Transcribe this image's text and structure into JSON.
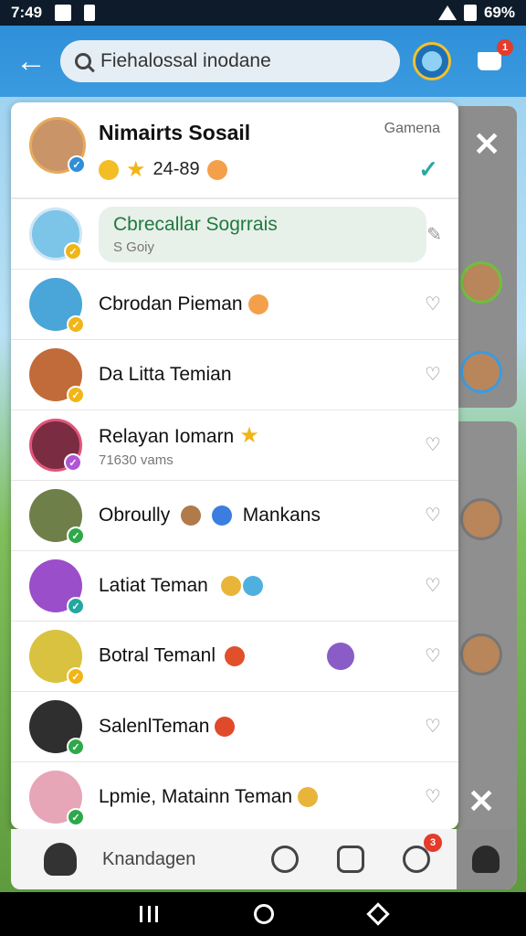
{
  "status_bar": {
    "time": "7:49",
    "battery": "69%"
  },
  "search": {
    "value": "Fiehalossal inodane",
    "placeholder": "Fiehalossal inodane"
  },
  "cart": {
    "badge": "1"
  },
  "header": {
    "title": "Nimairts Sosail",
    "stats": "24-89",
    "right_label": "Gamena"
  },
  "friends": [
    {
      "name": "Cbrecallar Sogrrais",
      "sub": "S Goiy",
      "highlight": true,
      "avatar_color": "#7cc4e8",
      "badge_color": "#f0b516"
    },
    {
      "name": "Cbrodan Pieman",
      "sub": "",
      "avatar_color": "#4aa6d8",
      "badge_color": "#f0b516"
    },
    {
      "name": "Da Litta Temian",
      "sub": "",
      "avatar_color": "#c26b3a",
      "badge_color": "#f0b516"
    },
    {
      "name": "Relayan Iomarn",
      "sub": "71630 vams",
      "avatar_color": "#7a2c42",
      "badge_color": "#b055d6"
    },
    {
      "name": "Obroully",
      "name2": "Mankans",
      "sub": "",
      "avatar_color": "#6f7f4a",
      "badge_color": "#2ea84a"
    },
    {
      "name": "Latiat Teman",
      "sub": "",
      "avatar_color": "#9b4ec9",
      "badge_color": "#23a7a0"
    },
    {
      "name": "Botral Temanl",
      "sub": "",
      "avatar_color": "#d9c23f",
      "badge_color": "#f0b516"
    },
    {
      "name": "SalenlTeman",
      "sub": "",
      "avatar_color": "#2f2f2f",
      "badge_color": "#2ea84a"
    },
    {
      "name": "Lpmie, Matainn Teman",
      "sub": "",
      "avatar_color": "#e6a6b8",
      "badge_color": "#2ea84a"
    }
  ],
  "bottom_nav": {
    "label": "Knandagen",
    "notification_badge": "3"
  },
  "colors": {
    "app_bar": "#3b9be0",
    "accent_green": "#2ea84a",
    "badge_red": "#e43b2a"
  },
  "icons": [
    "back-arrow-icon",
    "search-icon",
    "profile-icon",
    "cart-icon",
    "close-icon",
    "heart-icon",
    "pencil-icon",
    "home-icon",
    "chat-icon",
    "calendar-icon",
    "compass-icon",
    "user-icon"
  ]
}
